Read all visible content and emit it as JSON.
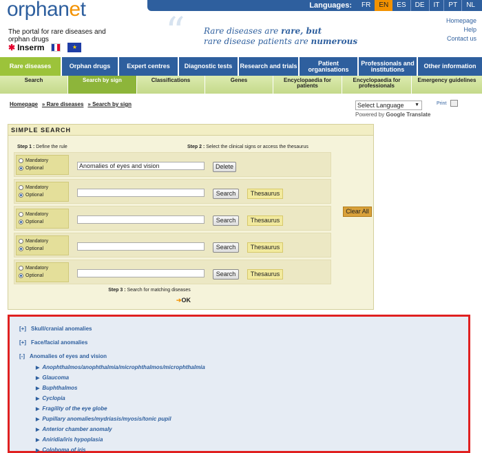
{
  "brand": {
    "logo_pre": "orphan",
    "logo_dot": "e",
    "logo_post": "t",
    "tagline": "The portal for rare diseases and orphan drugs",
    "partner": "Inserm"
  },
  "languages": {
    "label": "Languages:",
    "items": [
      "FR",
      "EN",
      "ES",
      "DE",
      "IT",
      "PT",
      "NL"
    ],
    "active": "EN"
  },
  "slogan": {
    "line1a": "Rare diseases are ",
    "line1b": "rare, but",
    "line2a": "rare disease patients are ",
    "line2b": "numerous"
  },
  "toplinks": [
    "Homepage",
    "Help",
    "Contact us"
  ],
  "mainnav": [
    "Rare diseases",
    "Orphan drugs",
    "Expert centres",
    "Diagnostic tests",
    "Research and trials",
    "Patient organisations",
    "Professionals and institutions",
    "Other information"
  ],
  "subnav": [
    "Search",
    "Search by sign",
    "Classifications",
    "Genes",
    "Encyclopaedia for patients",
    "Encyclopaedia for professionals",
    "Emergency guidelines"
  ],
  "breadcrumb": [
    "Homepage",
    "» Rare diseases",
    "» Search by sign"
  ],
  "translate": {
    "select": "Select Language",
    "powered": "Powered by ",
    "google": "Google",
    "word": " Translate"
  },
  "print_label": "Print",
  "search": {
    "title": "SIMPLE SEARCH",
    "step1_bold": "Step 1 :",
    "step1": " Define the rule",
    "step2_bold": "Step 2 :",
    "step2": " Select the clinical signs or access the thesaurus",
    "mandatory": "Mandatory",
    "optional": "Optional",
    "first_value": "Anomalies of eyes and vision",
    "delete": "Delete",
    "search": "Search",
    "thesaurus": "Thesaurus",
    "clear_all": "Clear All",
    "step3_bold": "Step 3 :",
    "step3": " Search for matching diseases",
    "ok": "OK"
  },
  "results": {
    "collapsed": [
      {
        "tog": "[+]",
        "label": "Skull/cranial anomalies"
      },
      {
        "tog": "[+]",
        "label": "Face/facial anomalies"
      }
    ],
    "expanded": {
      "tog": "[-]",
      "label": "Anomalies of eyes and vision"
    },
    "items": [
      "Anophthalmos/anophthalmia/microphthalmos/microphthalmia",
      "Glaucoma",
      "Buphthalmos",
      "Cyclopia",
      "Fragility of the eye globe",
      "Pupillary anomalies/mydriasis/myosis/tonic pupil",
      "Anterior chamber anomaly",
      "Aniridia/iris hypoplasia",
      "Coloboma of iris"
    ]
  }
}
